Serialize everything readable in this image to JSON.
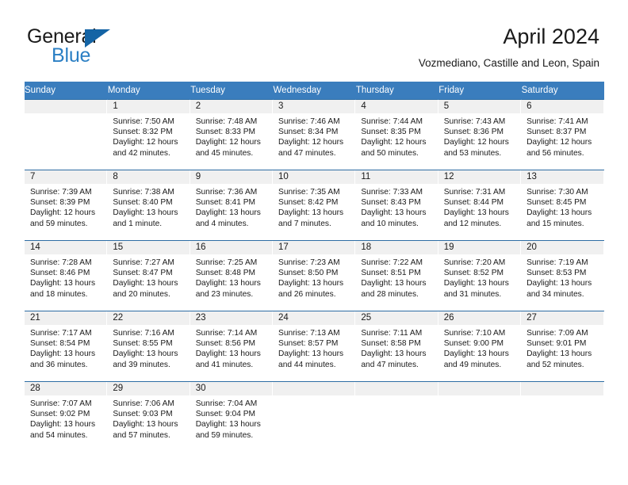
{
  "brand": {
    "name_line1": "General",
    "name_line2": "Blue",
    "logo_icon": "triangle-logo-icon"
  },
  "header": {
    "title": "April 2024",
    "subtitle": "Vozmediano, Castille and Leon, Spain"
  },
  "calendar": {
    "accent_color": "#3a7dbd",
    "rule_color": "#2e6da4",
    "daynum_band_color": "#f0f0f0",
    "weekday_headers": [
      "Sunday",
      "Monday",
      "Tuesday",
      "Wednesday",
      "Thursday",
      "Friday",
      "Saturday"
    ],
    "weeks": [
      [
        {
          "day": "",
          "detail": ""
        },
        {
          "day": "1",
          "detail": "Sunrise: 7:50 AM\nSunset: 8:32 PM\nDaylight: 12 hours\nand 42 minutes."
        },
        {
          "day": "2",
          "detail": "Sunrise: 7:48 AM\nSunset: 8:33 PM\nDaylight: 12 hours\nand 45 minutes."
        },
        {
          "day": "3",
          "detail": "Sunrise: 7:46 AM\nSunset: 8:34 PM\nDaylight: 12 hours\nand 47 minutes."
        },
        {
          "day": "4",
          "detail": "Sunrise: 7:44 AM\nSunset: 8:35 PM\nDaylight: 12 hours\nand 50 minutes."
        },
        {
          "day": "5",
          "detail": "Sunrise: 7:43 AM\nSunset: 8:36 PM\nDaylight: 12 hours\nand 53 minutes."
        },
        {
          "day": "6",
          "detail": "Sunrise: 7:41 AM\nSunset: 8:37 PM\nDaylight: 12 hours\nand 56 minutes."
        }
      ],
      [
        {
          "day": "7",
          "detail": "Sunrise: 7:39 AM\nSunset: 8:39 PM\nDaylight: 12 hours\nand 59 minutes."
        },
        {
          "day": "8",
          "detail": "Sunrise: 7:38 AM\nSunset: 8:40 PM\nDaylight: 13 hours\nand 1 minute."
        },
        {
          "day": "9",
          "detail": "Sunrise: 7:36 AM\nSunset: 8:41 PM\nDaylight: 13 hours\nand 4 minutes."
        },
        {
          "day": "10",
          "detail": "Sunrise: 7:35 AM\nSunset: 8:42 PM\nDaylight: 13 hours\nand 7 minutes."
        },
        {
          "day": "11",
          "detail": "Sunrise: 7:33 AM\nSunset: 8:43 PM\nDaylight: 13 hours\nand 10 minutes."
        },
        {
          "day": "12",
          "detail": "Sunrise: 7:31 AM\nSunset: 8:44 PM\nDaylight: 13 hours\nand 12 minutes."
        },
        {
          "day": "13",
          "detail": "Sunrise: 7:30 AM\nSunset: 8:45 PM\nDaylight: 13 hours\nand 15 minutes."
        }
      ],
      [
        {
          "day": "14",
          "detail": "Sunrise: 7:28 AM\nSunset: 8:46 PM\nDaylight: 13 hours\nand 18 minutes."
        },
        {
          "day": "15",
          "detail": "Sunrise: 7:27 AM\nSunset: 8:47 PM\nDaylight: 13 hours\nand 20 minutes."
        },
        {
          "day": "16",
          "detail": "Sunrise: 7:25 AM\nSunset: 8:48 PM\nDaylight: 13 hours\nand 23 minutes."
        },
        {
          "day": "17",
          "detail": "Sunrise: 7:23 AM\nSunset: 8:50 PM\nDaylight: 13 hours\nand 26 minutes."
        },
        {
          "day": "18",
          "detail": "Sunrise: 7:22 AM\nSunset: 8:51 PM\nDaylight: 13 hours\nand 28 minutes."
        },
        {
          "day": "19",
          "detail": "Sunrise: 7:20 AM\nSunset: 8:52 PM\nDaylight: 13 hours\nand 31 minutes."
        },
        {
          "day": "20",
          "detail": "Sunrise: 7:19 AM\nSunset: 8:53 PM\nDaylight: 13 hours\nand 34 minutes."
        }
      ],
      [
        {
          "day": "21",
          "detail": "Sunrise: 7:17 AM\nSunset: 8:54 PM\nDaylight: 13 hours\nand 36 minutes."
        },
        {
          "day": "22",
          "detail": "Sunrise: 7:16 AM\nSunset: 8:55 PM\nDaylight: 13 hours\nand 39 minutes."
        },
        {
          "day": "23",
          "detail": "Sunrise: 7:14 AM\nSunset: 8:56 PM\nDaylight: 13 hours\nand 41 minutes."
        },
        {
          "day": "24",
          "detail": "Sunrise: 7:13 AM\nSunset: 8:57 PM\nDaylight: 13 hours\nand 44 minutes."
        },
        {
          "day": "25",
          "detail": "Sunrise: 7:11 AM\nSunset: 8:58 PM\nDaylight: 13 hours\nand 47 minutes."
        },
        {
          "day": "26",
          "detail": "Sunrise: 7:10 AM\nSunset: 9:00 PM\nDaylight: 13 hours\nand 49 minutes."
        },
        {
          "day": "27",
          "detail": "Sunrise: 7:09 AM\nSunset: 9:01 PM\nDaylight: 13 hours\nand 52 minutes."
        }
      ],
      [
        {
          "day": "28",
          "detail": "Sunrise: 7:07 AM\nSunset: 9:02 PM\nDaylight: 13 hours\nand 54 minutes."
        },
        {
          "day": "29",
          "detail": "Sunrise: 7:06 AM\nSunset: 9:03 PM\nDaylight: 13 hours\nand 57 minutes."
        },
        {
          "day": "30",
          "detail": "Sunrise: 7:04 AM\nSunset: 9:04 PM\nDaylight: 13 hours\nand 59 minutes."
        },
        {
          "day": "",
          "detail": ""
        },
        {
          "day": "",
          "detail": ""
        },
        {
          "day": "",
          "detail": ""
        },
        {
          "day": "",
          "detail": ""
        }
      ]
    ]
  }
}
